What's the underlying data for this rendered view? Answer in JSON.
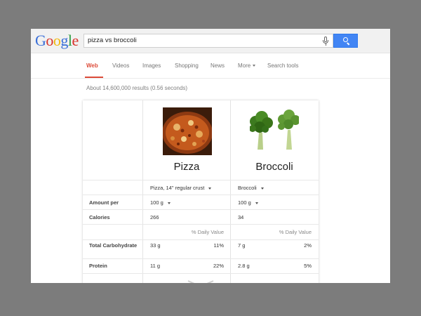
{
  "logo": {
    "letters": [
      "G",
      "o",
      "o",
      "g",
      "l",
      "e"
    ]
  },
  "search": {
    "query": "pizza vs broccoli"
  },
  "tabs": [
    {
      "label": "Web",
      "active": true
    },
    {
      "label": "Videos"
    },
    {
      "label": "Images"
    },
    {
      "label": "Shopping"
    },
    {
      "label": "News"
    },
    {
      "label": "More"
    },
    {
      "label": "Search tools"
    }
  ],
  "stats": "About 14,600,000 results (0.56 seconds)",
  "comparison": {
    "foods": [
      {
        "name": "Pizza",
        "serving": "Pizza, 14\" regular crust",
        "amount": "100 g",
        "calories": "266"
      },
      {
        "name": "Broccoli",
        "serving": "Broccoli",
        "amount": "100 g",
        "calories": "34"
      }
    ],
    "labels": {
      "amount_per": "Amount per",
      "calories": "Calories",
      "daily_value": "% Daily Value",
      "total_carbohydrate": "Total Carbohydrate",
      "protein": "Protein"
    },
    "nutrients": {
      "carbs": [
        {
          "amount": "33 g",
          "dv": "11%"
        },
        {
          "amount": "7 g",
          "dv": "2%"
        }
      ],
      "protein": [
        {
          "amount": "11 g",
          "dv": "22%"
        },
        {
          "amount": "2.8 g",
          "dv": "5%"
        }
      ]
    }
  },
  "colors": {
    "accent": "#dd4b39",
    "search_button": "#4285f4",
    "background": "#7c7c7c"
  }
}
